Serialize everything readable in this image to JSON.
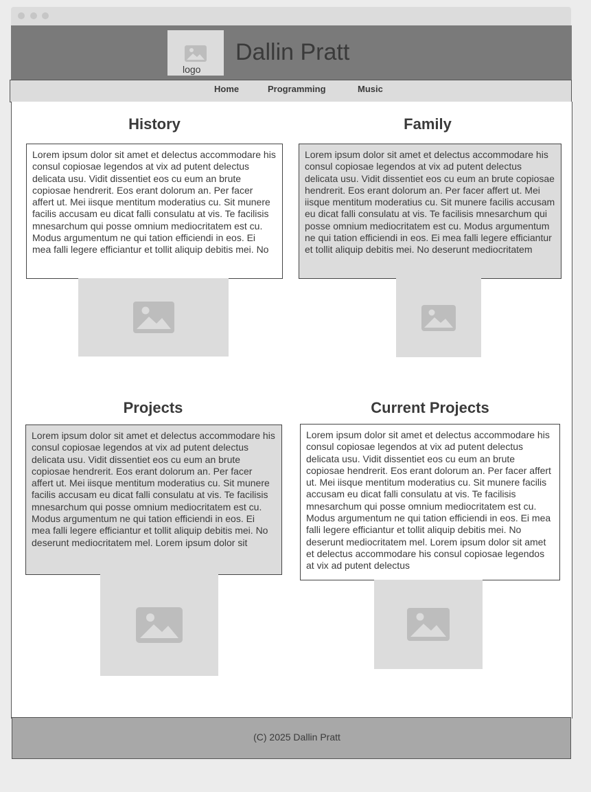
{
  "window": {
    "controls": [
      "close",
      "minimize",
      "maximize"
    ]
  },
  "header": {
    "logo_label": "logo",
    "site_title": "Dallin Pratt",
    "logo_icon": "image-placeholder-icon"
  },
  "nav": {
    "items": [
      {
        "label": "Home"
      },
      {
        "label": "Programming"
      },
      {
        "label": "Music"
      }
    ]
  },
  "sections": {
    "history": {
      "title": "History",
      "text": "Lorem ipsum dolor sit amet et delectus accommodare his consul copiosae legendos at vix ad putent delectus delicata usu. Vidit dissentiet eos cu eum an brute copiosae hendrerit. Eos erant dolorum an. Per facer affert ut. Mei iisque mentitum moderatius cu. Sit munere facilis accusam eu dicat falli consulatu at vis. Te facilisis mnesarchum qui posse omnium mediocritatem est cu. Modus argumentum ne qui tation efficiendi in eos. Ei mea falli legere efficiantur et tollit aliquip debitis mei. No"
    },
    "family": {
      "title": "Family",
      "text": "Lorem ipsum dolor sit amet et delectus accommodare his consul copiosae legendos at vix ad putent delectus delicata usu. Vidit dissentiet eos cu eum an brute copiosae hendrerit. Eos erant dolorum an. Per facer affert ut. Mei iisque mentitum moderatius cu. Sit munere facilis accusam eu dicat falli consulatu at vis. Te facilisis mnesarchum qui posse omnium mediocritatem est cu. Modus argumentum ne qui tation efficiendi in eos. Ei mea falli legere efficiantur et tollit aliquip debitis mei. No deserunt mediocritatem"
    },
    "projects": {
      "title": "Projects",
      "text": "Lorem ipsum dolor sit amet et delectus accommodare his consul copiosae legendos at vix ad putent delectus delicata usu. Vidit dissentiet eos cu eum an brute copiosae hendrerit. Eos erant dolorum an. Per facer affert ut. Mei iisque mentitum moderatius cu. Sit munere facilis accusam eu dicat falli consulatu at vis. Te facilisis mnesarchum qui posse omnium mediocritatem est cu. Modus argumentum ne qui tation efficiendi in eos. Ei mea falli legere efficiantur et tollit aliquip debitis mei. No deserunt mediocritatem mel. Lorem ipsum dolor sit"
    },
    "current_projects": {
      "title": "Current Projects",
      "text": "Lorem ipsum dolor sit amet et delectus accommodare his consul copiosae legendos at vix ad putent delectus delicata usu. Vidit dissentiet eos cu eum an brute copiosae hendrerit. Eos erant dolorum an. Per facer affert ut. Mei iisque mentitum moderatius cu. Sit munere facilis accusam eu dicat falli consulatu at vis. Te facilisis mnesarchum qui posse omnium mediocritatem est cu. Modus argumentum ne qui tation efficiendi in eos. Ei mea falli legere efficiantur et tollit aliquip debitis mei. No deserunt mediocritatem mel. Lorem ipsum dolor sit amet et delectus accommodare his consul copiosae legendos at vix ad putent delectus"
    }
  },
  "footer": {
    "text": "(C) 2025 Dallin Pratt"
  },
  "colors": {
    "header_bg": "#7a7a7a",
    "nav_bg": "#dcdcdc",
    "placeholder_bg": "#dcdcdc",
    "placeholder_icon": "#bdbdbd",
    "footer_bg": "#a8a8a8",
    "text": "#3a3a3a"
  }
}
